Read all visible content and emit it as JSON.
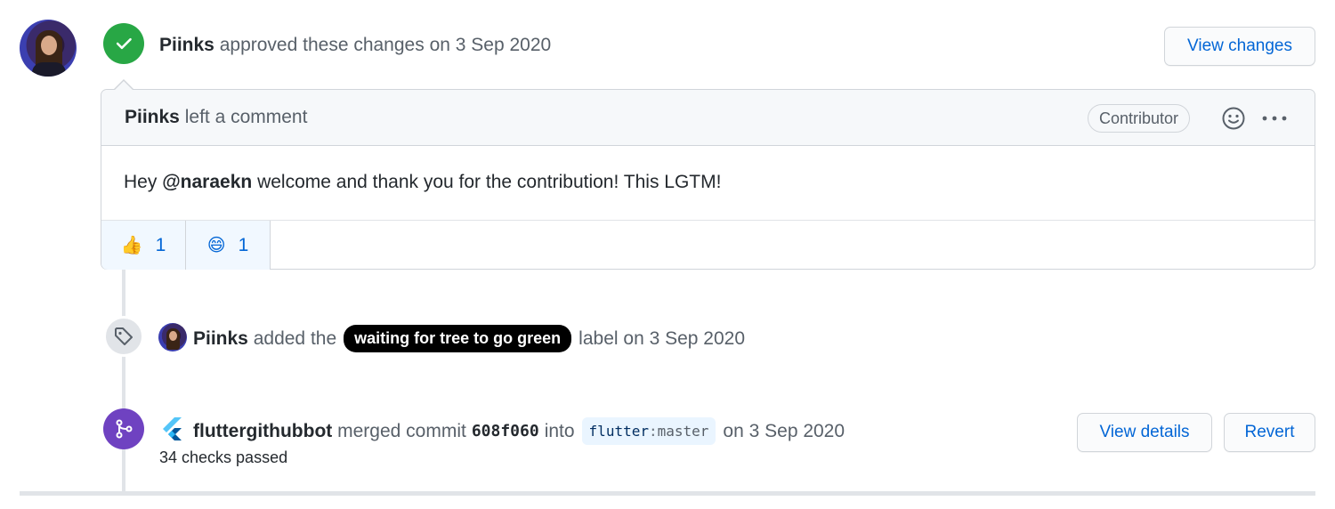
{
  "review": {
    "author": "Piinks",
    "action": "approved these changes",
    "date": "on 3 Sep 2020",
    "view_changes_label": "View changes"
  },
  "comment": {
    "author": "Piinks",
    "action": "left a comment",
    "role_badge": "Contributor",
    "body_prefix": "Hey",
    "mention": "@naraekn",
    "body_suffix": "welcome and thank you for the contribution! This LGTM!",
    "reactions": [
      {
        "emoji": "👍",
        "count": "1"
      },
      {
        "emoji": "😄",
        "count": "1"
      }
    ]
  },
  "label_event": {
    "author": "Piinks",
    "action": "added the",
    "label": "waiting for tree to go green",
    "suffix": "label",
    "date": "on 3 Sep 2020"
  },
  "merge_event": {
    "author": "fluttergithubbot",
    "action": "merged commit",
    "commit": "608f060",
    "into": "into",
    "branch_repo": "flutter",
    "branch_sep": ":",
    "branch_name": "master",
    "date": "on 3 Sep 2020",
    "checks": "34 checks passed",
    "view_details_label": "View details",
    "revert_label": "Revert"
  },
  "colors": {
    "approved": "#28a745",
    "merged": "#6f42c1",
    "link": "#0366d6"
  }
}
